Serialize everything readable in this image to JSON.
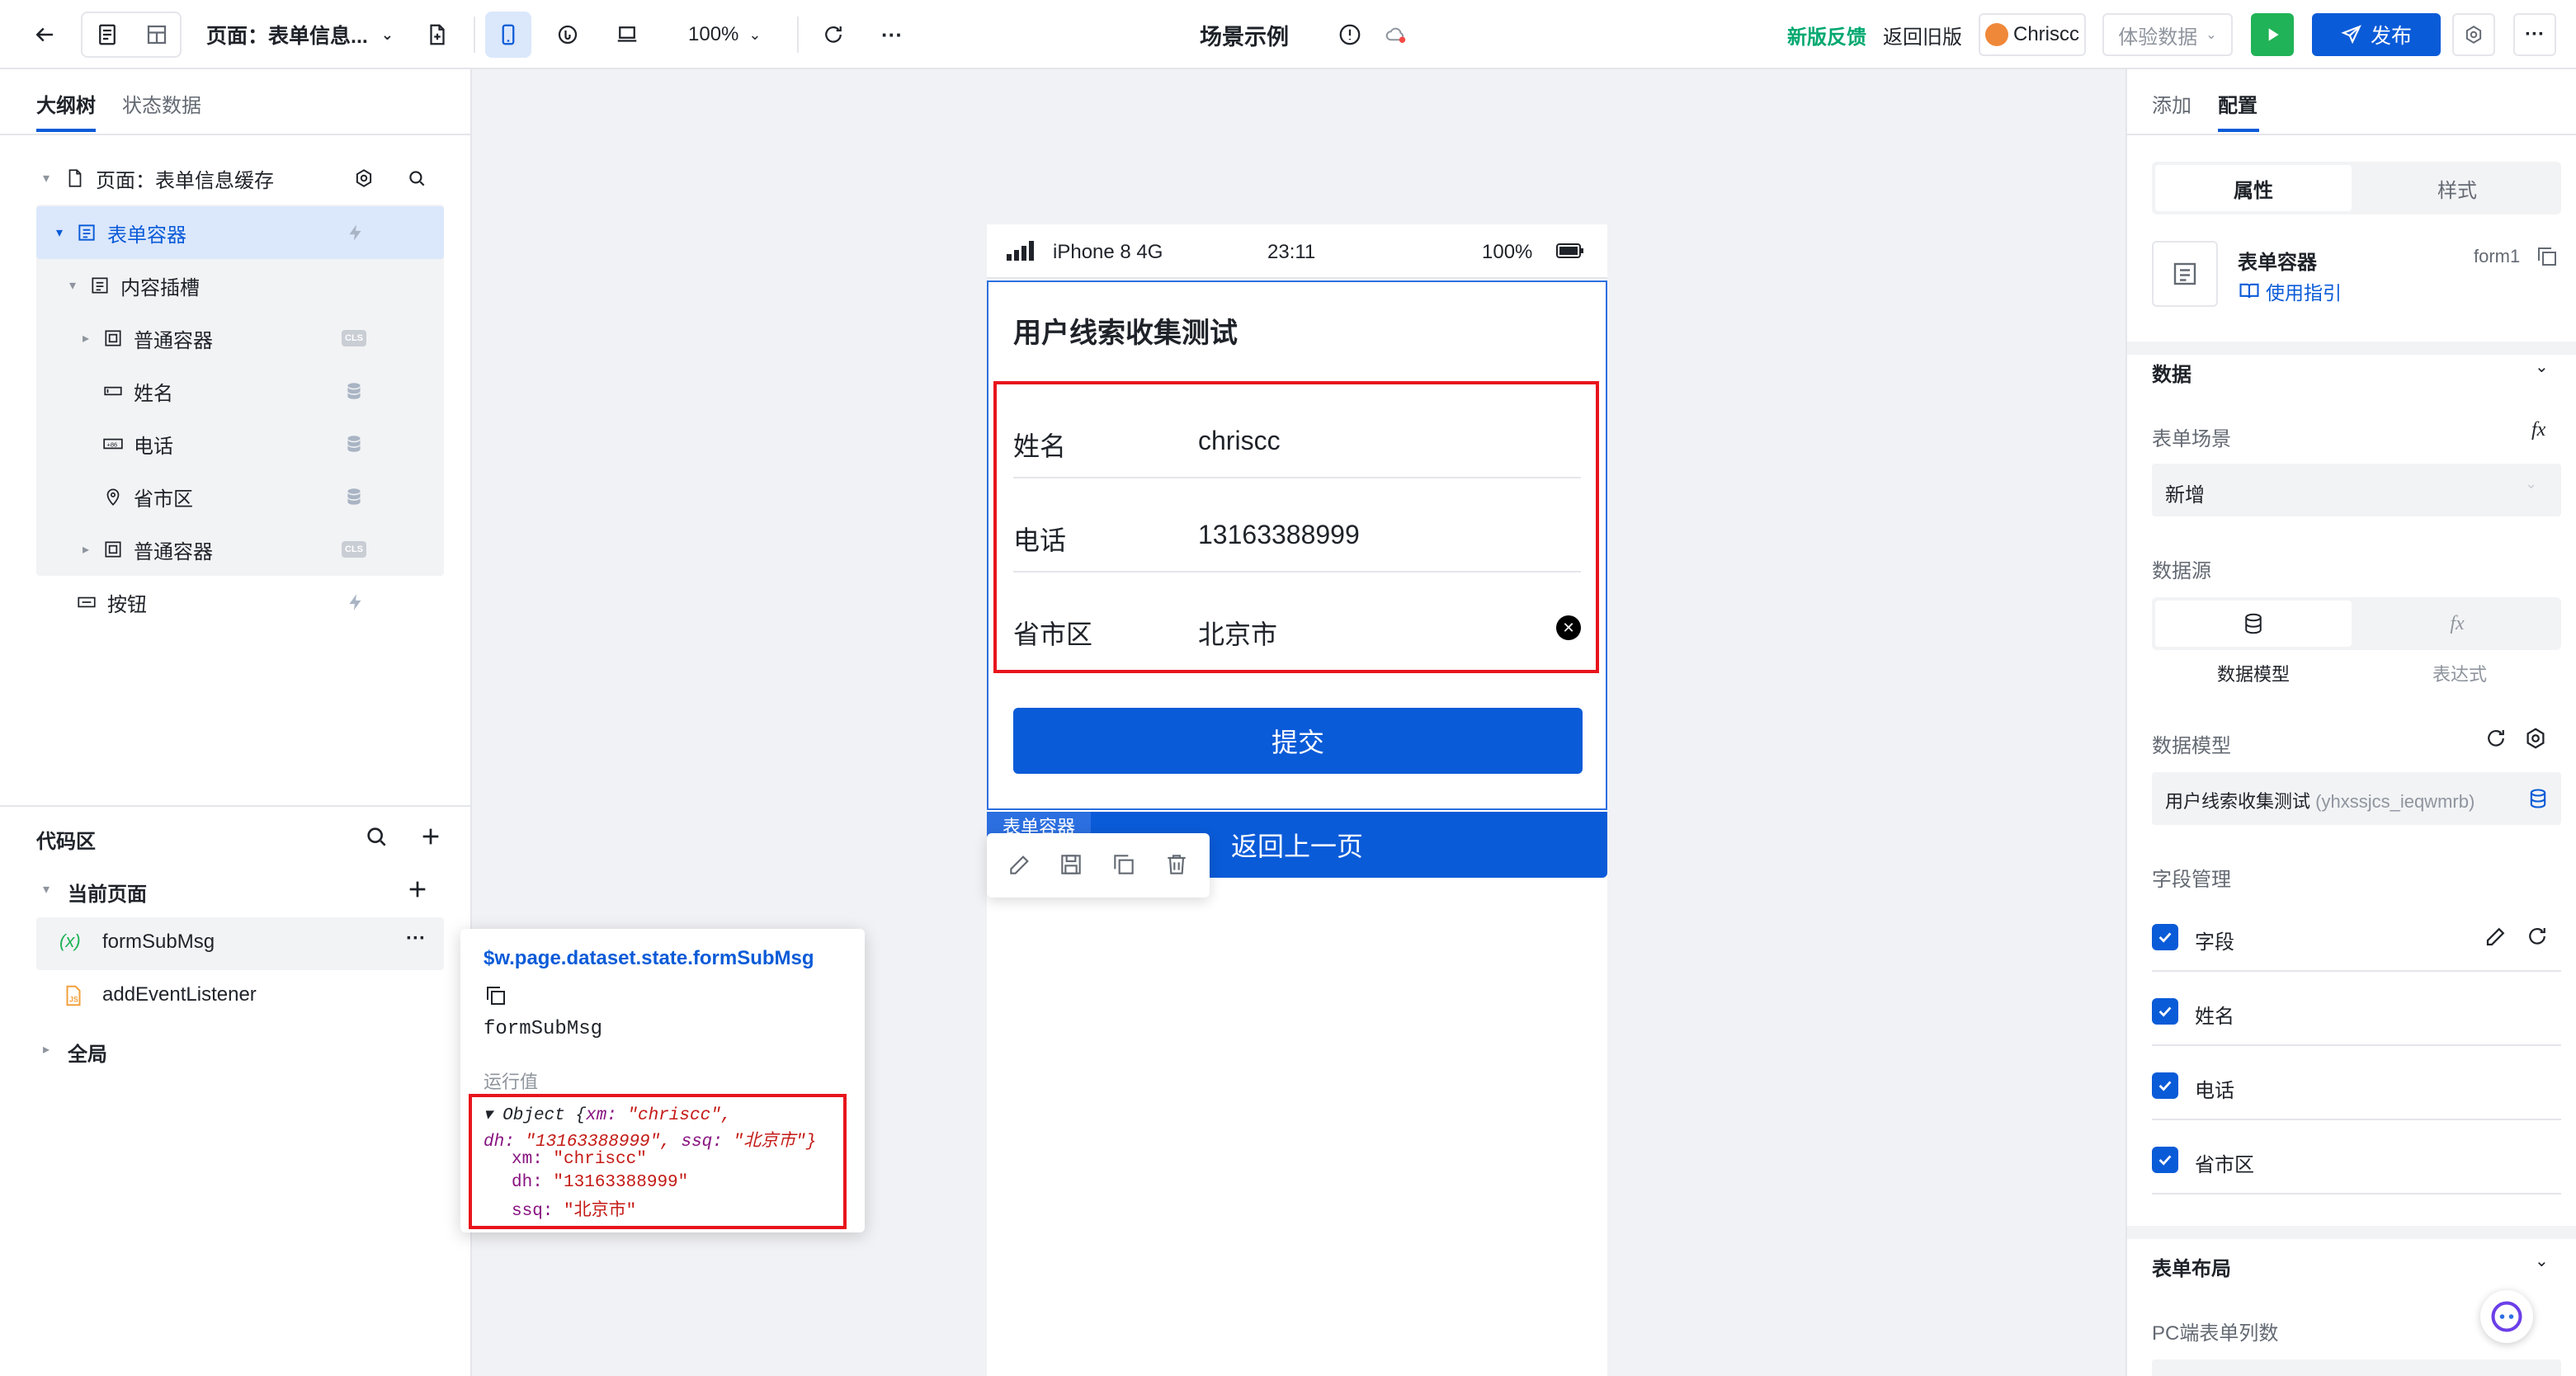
{
  "topbar": {
    "page_label": "页面：表单信息...",
    "zoom": "100%",
    "more": "···",
    "title": "场景示例",
    "feedback": "新版反馈",
    "return_old": "返回旧版",
    "user": "Chriscc",
    "experience": "体验数据",
    "publish": "发布"
  },
  "left": {
    "tabs": [
      "大纲树",
      "状态数据"
    ],
    "tree": {
      "page": "页面：表单信息缓存",
      "form_container": "表单容器",
      "content_slot": "内容插槽",
      "container1": "普通容器",
      "name": "姓名",
      "phone": "电话",
      "region": "省市区",
      "container2": "普通容器",
      "button": "按钮"
    },
    "code_title": "代码区",
    "current_page": "当前页面",
    "code_items": [
      "formSubMsg",
      "addEventListener"
    ],
    "var_prefix": "(x)",
    "global": "全局"
  },
  "popover": {
    "path": "$w.page.dataset.state.formSubMsg",
    "name": "formSubMsg",
    "runtime_label": "运行值",
    "obj_line1_prefix": "▾ Object {",
    "obj_line1_key": "xm: ",
    "obj_line1_val": "\"chriscc\",",
    "obj_line2_key1": "dh: ",
    "obj_line2_val1": "\"13163388999\",",
    "obj_line2_key2": " ssq: ",
    "obj_line2_val2": "\"北京市\"}",
    "lines": [
      {
        "key": "xm: ",
        "val": "\"chriscc\""
      },
      {
        "key": "dh: ",
        "val": "\"13163388999\""
      },
      {
        "key": "ssq: ",
        "val": "\"北京市\""
      }
    ]
  },
  "phone": {
    "carrier": "iPhone 8  4G",
    "time": "23:11",
    "battery": "100%",
    "form_title": "用户线索收集测试",
    "fields": [
      {
        "label": "姓名",
        "value": "chriscc"
      },
      {
        "label": "电话",
        "value": "13163388999"
      },
      {
        "label": "省市区",
        "value": "北京市"
      }
    ],
    "submit": "提交",
    "container_tag": "表单容器",
    "back": "返回上一页"
  },
  "right": {
    "tabs": [
      "添加",
      "配置"
    ],
    "subtabs": [
      "属性",
      "样式"
    ],
    "component_name": "表单容器",
    "component_id": "form1",
    "guide": "使用指引",
    "data_section": "数据",
    "scene_label": "表单场景",
    "fx": "fx",
    "scene_value": "新增",
    "source_label": "数据源",
    "source_model": "数据模型",
    "source_expr": "表达式",
    "model_label": "数据模型",
    "model_value": "用户线索收集测试",
    "model_id": "(yhxssjcs_ieqwmrb)",
    "field_mgmt": "字段管理",
    "fields": [
      "字段",
      "姓名",
      "电话",
      "省市区"
    ],
    "layout_section": "表单布局",
    "pc_cols": "PC端表单列数"
  },
  "colors": {
    "primary": "#0a5bd8",
    "green": "#21b357",
    "red_highlight": "#e8141c",
    "feedback_green": "#00a870"
  }
}
